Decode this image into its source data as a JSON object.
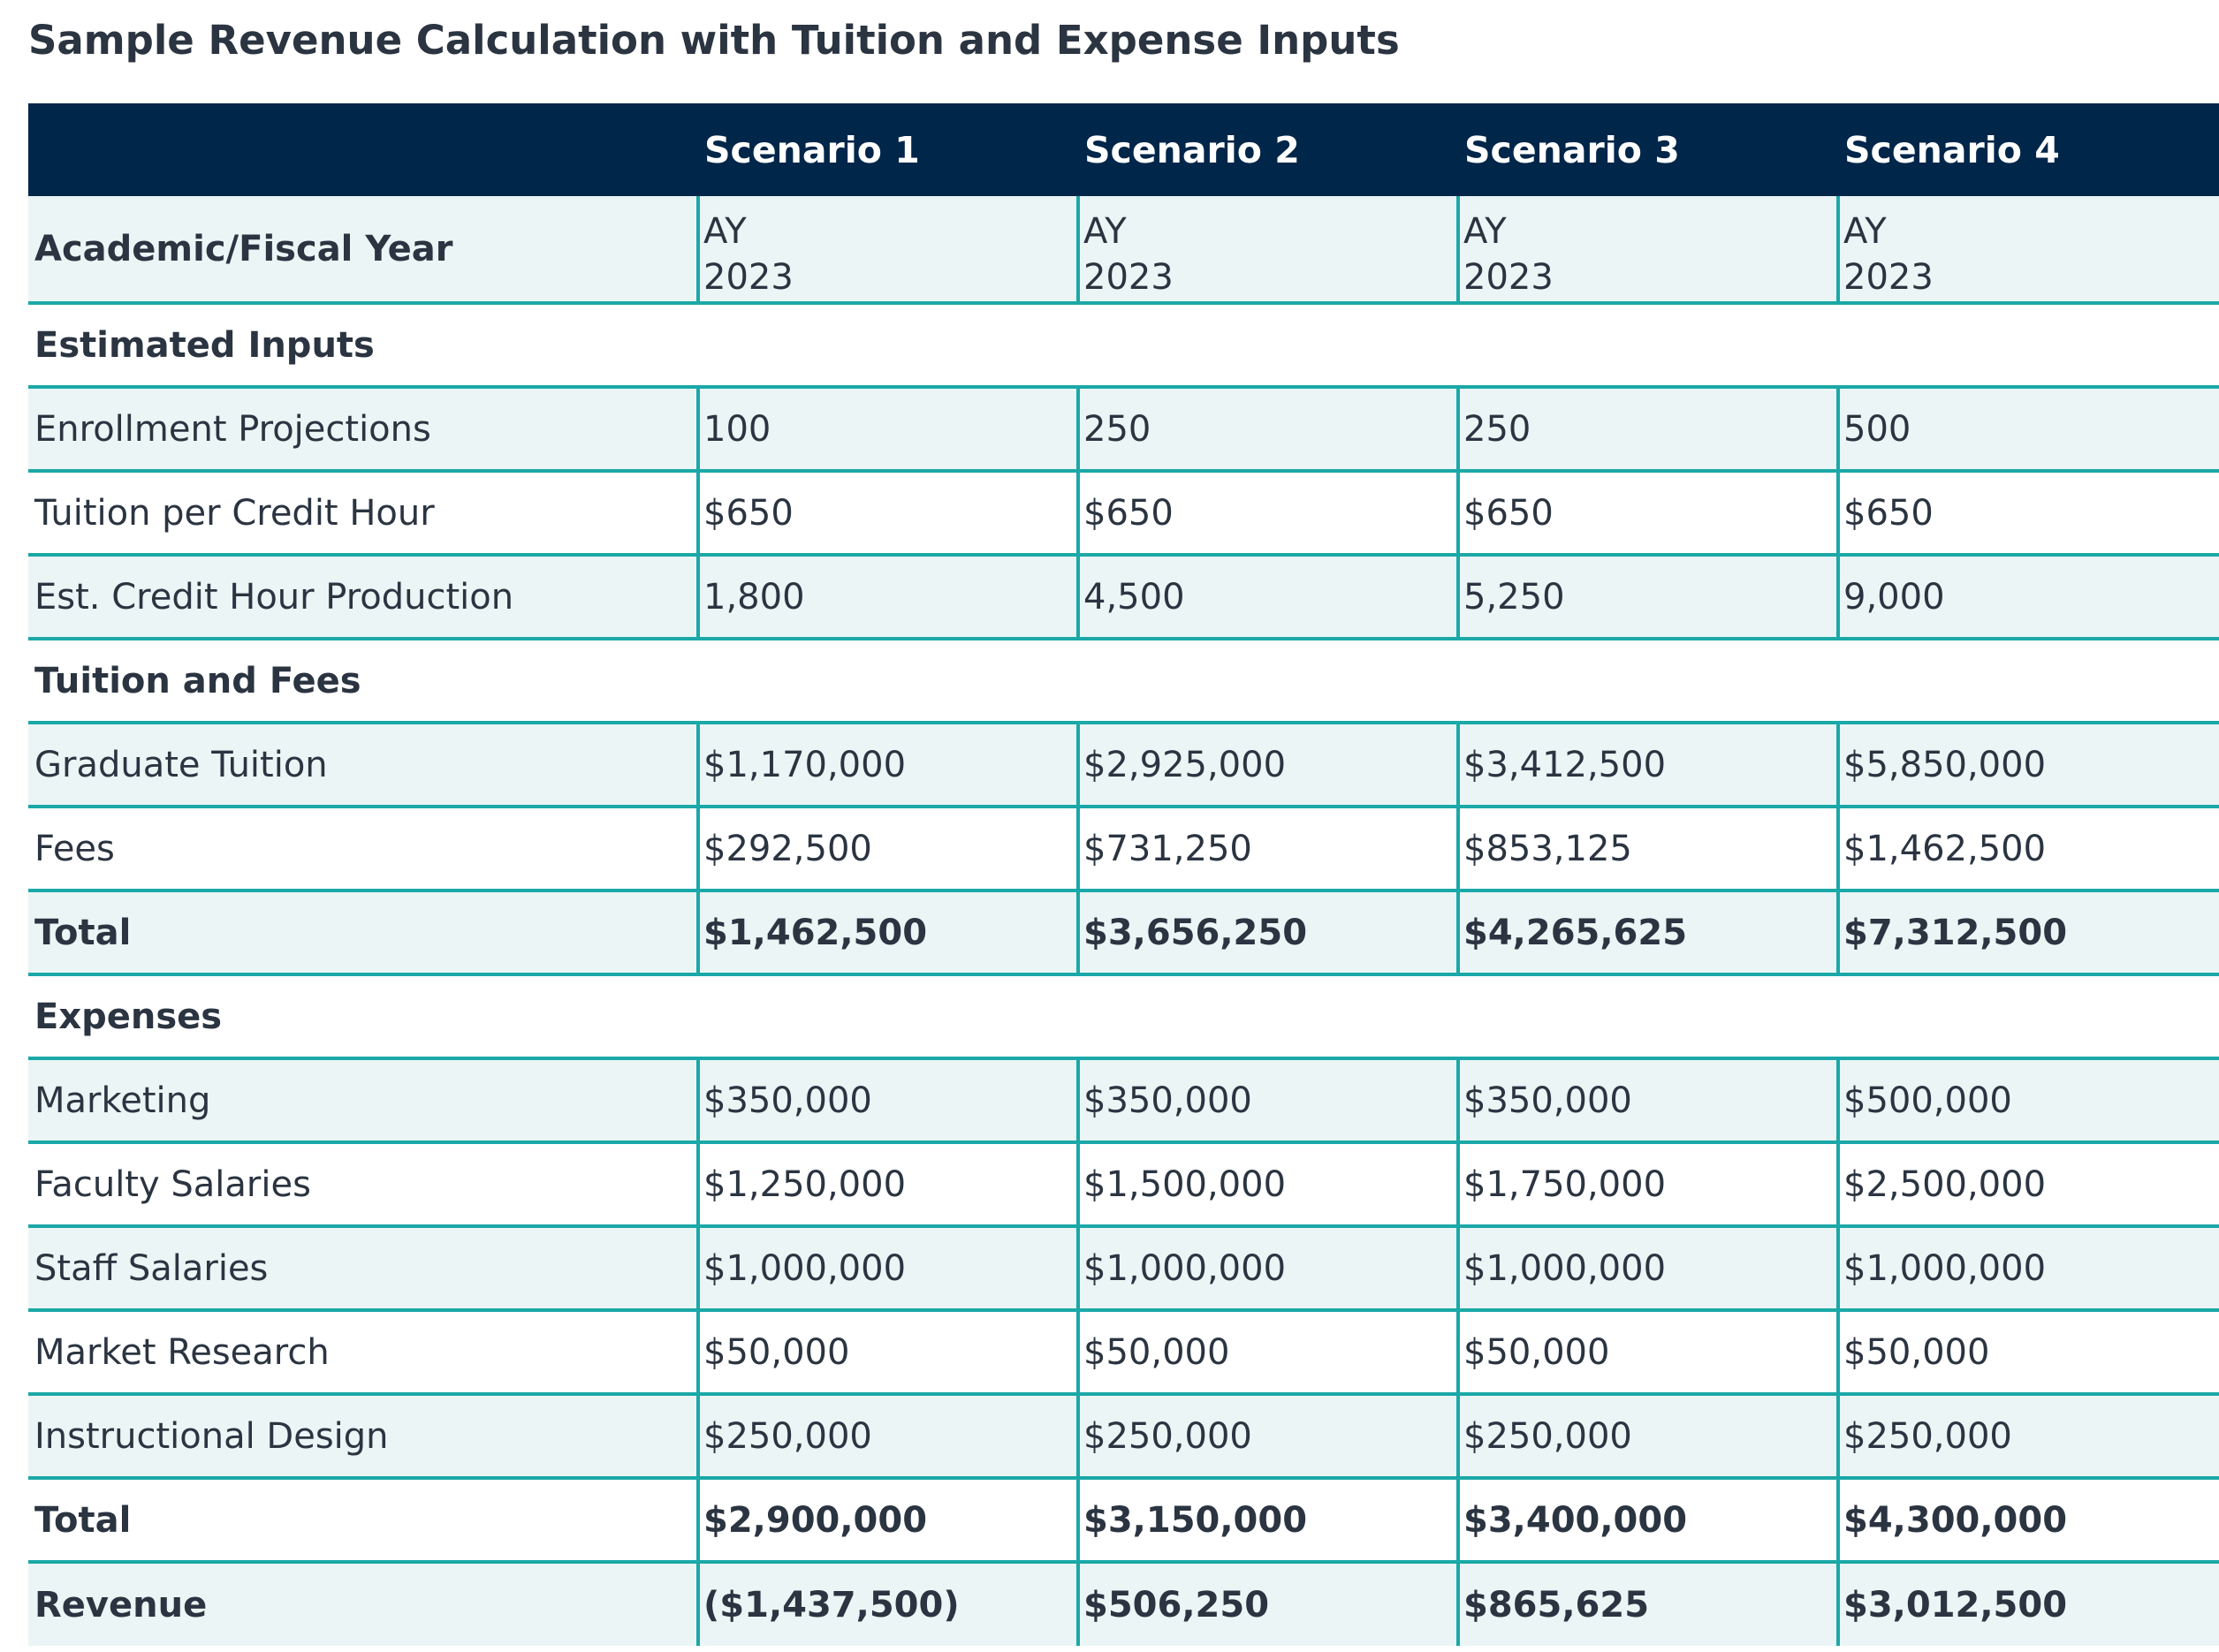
{
  "title": "Sample Revenue Calculation with Tuition and Expense Inputs",
  "columns": [
    "",
    "Scenario 1",
    "Scenario 2",
    "Scenario 3",
    "Scenario 4"
  ],
  "year_row": {
    "label": "Academic/Fiscal Year",
    "values": [
      {
        "line1": "AY",
        "line2": "2023"
      },
      {
        "line1": "AY",
        "line2": "2023"
      },
      {
        "line1": "AY",
        "line2": "2023"
      },
      {
        "line1": "AY",
        "line2": "2023"
      }
    ]
  },
  "sections": {
    "estimated_inputs": "Estimated Inputs",
    "tuition_and_fees": "Tuition and Fees",
    "expenses": "Expenses"
  },
  "rows": {
    "enrollment": {
      "label": "Enrollment Projections",
      "values": [
        "100",
        "250",
        "250",
        "500"
      ]
    },
    "tuition_per_credit": {
      "label": "Tuition per Credit Hour",
      "values": [
        "$650",
        "$650",
        "$650",
        "$650"
      ]
    },
    "credit_hours": {
      "label": "Est. Credit Hour Production",
      "values": [
        "1,800",
        "4,500",
        "5,250",
        "9,000"
      ]
    },
    "graduate_tuition": {
      "label": "Graduate Tuition",
      "values": [
        "$1,170,000",
        "$2,925,000",
        "$3,412,500",
        "$5,850,000"
      ]
    },
    "fees": {
      "label": "Fees",
      "values": [
        "$292,500",
        "$731,250",
        "$853,125",
        "$1,462,500"
      ]
    },
    "tuition_total": {
      "label": "Total",
      "values": [
        "$1,462,500",
        "$3,656,250",
        "$4,265,625",
        "$7,312,500"
      ]
    },
    "marketing": {
      "label": "Marketing",
      "values": [
        "$350,000",
        "$350,000",
        "$350,000",
        "$500,000"
      ]
    },
    "faculty_salaries": {
      "label": "Faculty Salaries",
      "values": [
        "$1,250,000",
        "$1,500,000",
        "$1,750,000",
        "$2,500,000"
      ]
    },
    "staff_salaries": {
      "label": "Staff Salaries",
      "values": [
        "$1,000,000",
        "$1,000,000",
        "$1,000,000",
        "$1,000,000"
      ]
    },
    "market_research": {
      "label": "Market Research",
      "values": [
        "$50,000",
        "$50,000",
        "$50,000",
        "$50,000"
      ]
    },
    "instructional_design": {
      "label": "Instructional Design",
      "values": [
        "$250,000",
        "$250,000",
        "$250,000",
        "$250,000"
      ]
    },
    "expense_total": {
      "label": "Total",
      "values": [
        "$2,900,000",
        "$3,150,000",
        "$3,400,000",
        "$4,300,000"
      ]
    },
    "revenue": {
      "label": "Revenue",
      "values": [
        "($1,437,500)",
        "$506,250",
        "$865,625",
        "$3,012,500"
      ]
    }
  }
}
